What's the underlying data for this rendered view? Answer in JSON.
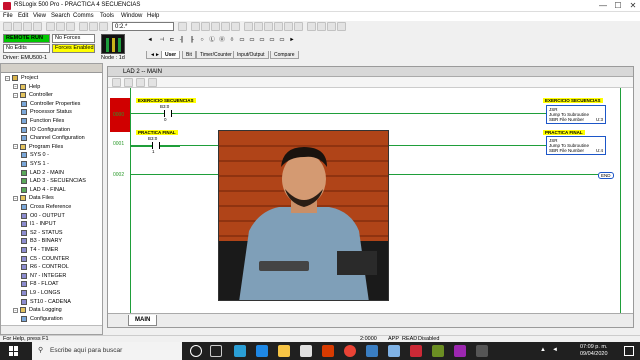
{
  "window": {
    "title": "RSLogix 500 Pro - PRACTICA 4 SECUENCIAS",
    "min": "—",
    "max": "☐",
    "close": "✕"
  },
  "menu": [
    "File",
    "Edit",
    "View",
    "Search",
    "Comms",
    "Tools",
    "Window",
    "Help"
  ],
  "toolbar": {
    "ladder_view": "0:2.*"
  },
  "status_panel": {
    "mode": "REMOTE RUN",
    "forces": "No Forces",
    "edits": "No Edits",
    "forces_enabled": "Forces Enabled",
    "driver": "Driver: EMU500-1",
    "node": "Node : 1d"
  },
  "palette_tabs": [
    "User",
    "Bit",
    "Timer/Counter",
    "Input/Output",
    "Compare"
  ],
  "tree": {
    "items": [
      {
        "label": "Project",
        "level": 0,
        "type": "root"
      },
      {
        "label": "Help",
        "level": 1,
        "type": "folder"
      },
      {
        "label": "Controller",
        "level": 1,
        "type": "folder"
      },
      {
        "label": "Controller Properties",
        "level": 2,
        "type": "file"
      },
      {
        "label": "Processor Status",
        "level": 2,
        "type": "file"
      },
      {
        "label": "Function Files",
        "level": 2,
        "type": "file"
      },
      {
        "label": "IO Configuration",
        "level": 2,
        "type": "file"
      },
      {
        "label": "Channel Configuration",
        "level": 2,
        "type": "file"
      },
      {
        "label": "Program Files",
        "level": 1,
        "type": "folder"
      },
      {
        "label": "SYS 0 -",
        "level": 2,
        "type": "file"
      },
      {
        "label": "SYS 1 -",
        "level": 2,
        "type": "file"
      },
      {
        "label": "LAD 2 - MAIN",
        "level": 2,
        "type": "ladder"
      },
      {
        "label": "LAD 3 - SECUENCIAS",
        "level": 2,
        "type": "ladder"
      },
      {
        "label": "LAD 4 - FINAL",
        "level": 2,
        "type": "ladder"
      },
      {
        "label": "Data Files",
        "level": 1,
        "type": "folder"
      },
      {
        "label": "Cross Reference",
        "level": 2,
        "type": "file"
      },
      {
        "label": "O0 - OUTPUT",
        "level": 2,
        "type": "data"
      },
      {
        "label": "I1 - INPUT",
        "level": 2,
        "type": "data"
      },
      {
        "label": "S2 - STATUS",
        "level": 2,
        "type": "data"
      },
      {
        "label": "B3 - BINARY",
        "level": 2,
        "type": "data"
      },
      {
        "label": "T4 - TIMER",
        "level": 2,
        "type": "data"
      },
      {
        "label": "C5 - COUNTER",
        "level": 2,
        "type": "data"
      },
      {
        "label": "R6 - CONTROL",
        "level": 2,
        "type": "data"
      },
      {
        "label": "N7 - INTEGER",
        "level": 2,
        "type": "data"
      },
      {
        "label": "F8 - FLOAT",
        "level": 2,
        "type": "data"
      },
      {
        "label": "L9 - LONGS",
        "level": 2,
        "type": "data"
      },
      {
        "label": "ST10 - CADENA",
        "level": 2,
        "type": "data"
      },
      {
        "label": "Data Logging",
        "level": 1,
        "type": "folder"
      },
      {
        "label": "Configuration",
        "level": 2,
        "type": "file"
      }
    ]
  },
  "ladder": {
    "title": "LAD 2 -- MAIN",
    "tab": "MAIN",
    "rungs": [
      {
        "num": "0000",
        "comment": "EXERCICIO SECUENCIAS",
        "addr": "B3:0",
        "bit": "0",
        "out_comment": "EXERCICIO SECUENCIAS",
        "jsr_title": "JSR",
        "jsr_line1": "Jump To Subroutine",
        "jsr_line2": "SBR File Number",
        "jsr_value": "U:3"
      },
      {
        "num": "0001",
        "comment": "PRACTICA FINAL",
        "addr": "B3:0",
        "bit": "1",
        "out_comment": "PRACTICA FINAL",
        "jsr_title": "JSR",
        "jsr_line1": "Jump To Subroutine",
        "jsr_line2": "SBR File Number",
        "jsr_value": "U:4"
      },
      {
        "num": "0002",
        "end": "END"
      }
    ]
  },
  "statusbar": {
    "help": "For Help, press F1",
    "zoom": "2:0000",
    "mode1": "APP",
    "mode2": "READ",
    "mode3": "Disabled"
  },
  "taskbar": {
    "search_placeholder": "Escribe aquí para buscar",
    "time": "07:09 p. m.",
    "date": "09/04/2020"
  }
}
